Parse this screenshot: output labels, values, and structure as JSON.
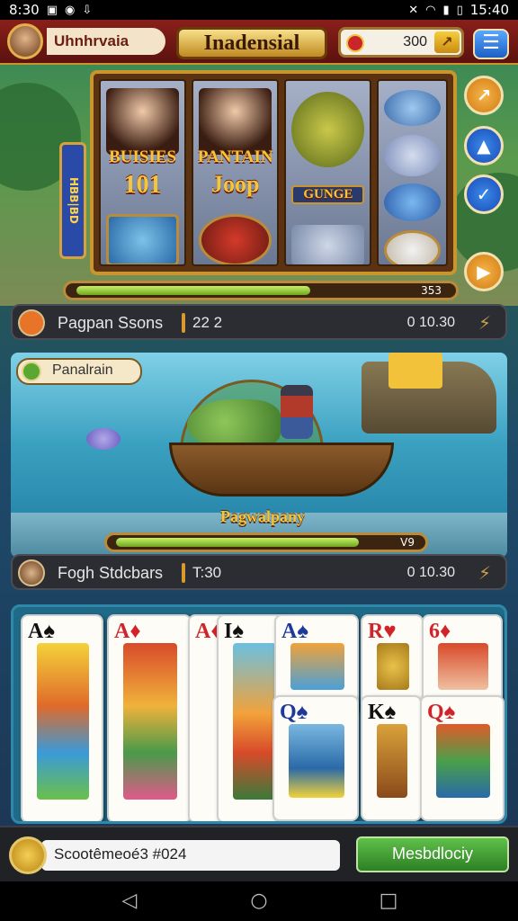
{
  "status_bar": {
    "time_left": "8:30",
    "time_right": "15:40"
  },
  "header": {
    "player_name": "Uhnhrvaia",
    "game_title": "Inadensial",
    "coins": "300",
    "coin_add": "↗",
    "menu": "☰"
  },
  "slots": {
    "side_label": "HBB|BD",
    "reel1": {
      "text_top": "BUISIES",
      "text_bottom": "101"
    },
    "reel2": {
      "text_top": "PANTAIN",
      "text_bottom": "Joop"
    },
    "reel3": {
      "text_mid": "GUNGE"
    },
    "progress_value": "353",
    "progress_fraction": 0.65,
    "buttons": [
      "↗",
      "▲",
      "✓",
      "▶"
    ]
  },
  "info1": {
    "title": "Pagpan Ssons",
    "count": "22 2",
    "score": "0 10.30",
    "action": "⚡"
  },
  "fish_scene": {
    "tag": "Panalrain",
    "caption": "Pagwalpany",
    "progress_value": "V9",
    "progress_fraction": 0.9
  },
  "info2": {
    "title": "Fogh Stdcbars",
    "count": "T:30",
    "score": "0 10.30",
    "action": "⚡"
  },
  "cards": [
    {
      "rank": "A",
      "suit": "♠",
      "color": "black"
    },
    {
      "rank": "A",
      "suit": "♦",
      "color": "red"
    },
    {
      "rank": "A",
      "suit": "♦",
      "color": "red"
    },
    {
      "rank": "I",
      "suit": "♠",
      "color": "black"
    },
    {
      "rank": "A",
      "suit": "♠",
      "color": "blue"
    },
    {
      "rank": "R",
      "suit": "♥",
      "color": "red"
    },
    {
      "rank": "6",
      "suit": "♦",
      "color": "red"
    },
    {
      "rank": "Q",
      "suit": "♠",
      "color": "blue"
    },
    {
      "rank": "K",
      "suit": "♠",
      "color": "black"
    },
    {
      "rank": "Q",
      "suit": "♠",
      "color": "red"
    }
  ],
  "bottom": {
    "field_text": "Scootêmeoé3 #024",
    "button_label": "Mesbdlociy"
  },
  "nav": {
    "back": "◁",
    "home": "○",
    "recent": "□"
  }
}
